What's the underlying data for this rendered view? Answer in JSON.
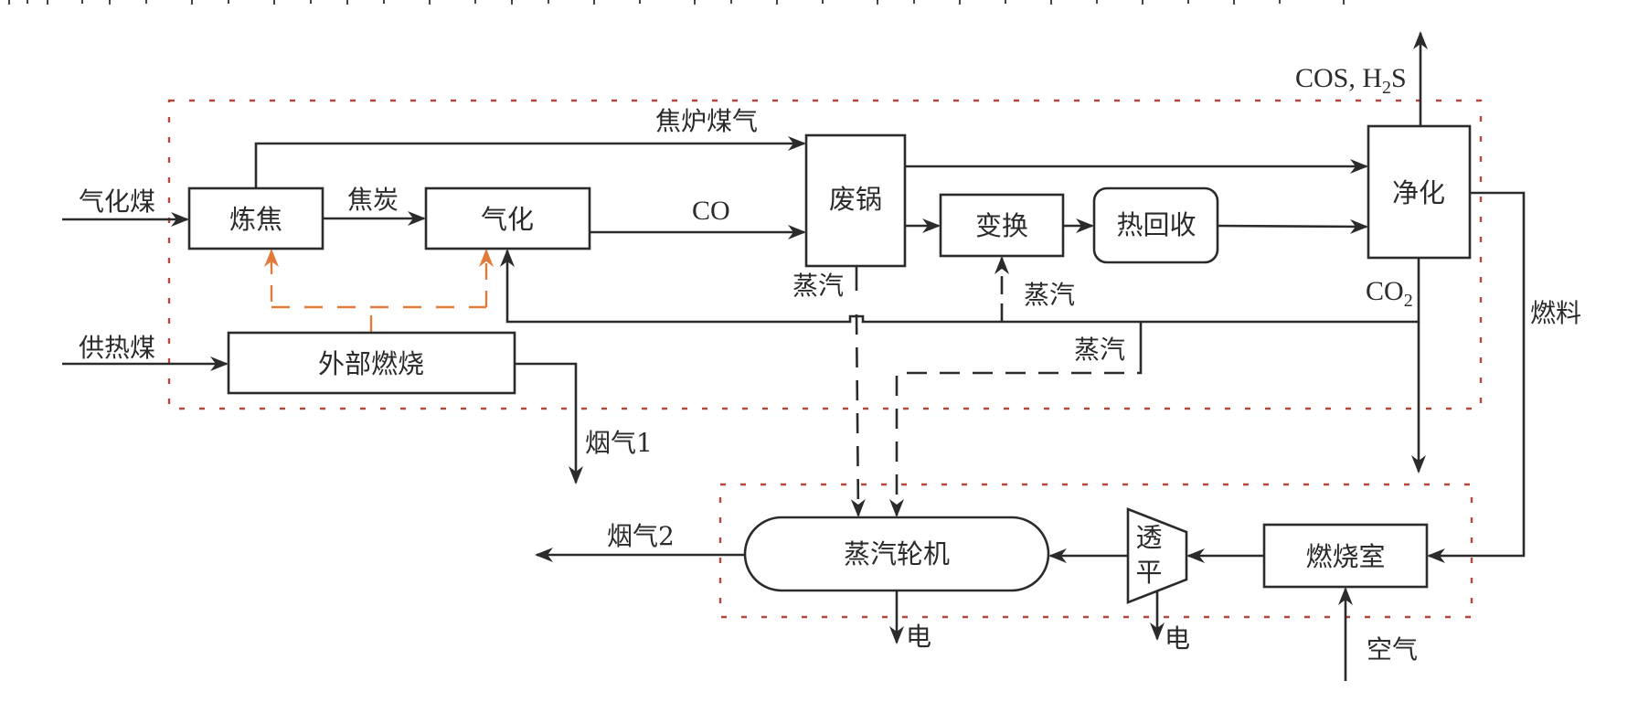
{
  "colors": {
    "stroke": "#2b2b2b",
    "heat_supply": "#e07b39",
    "boundary": "#b5473c"
  },
  "units": {
    "coking": "炼焦",
    "gasification": "气化",
    "external_combustion": "外部燃烧",
    "waste_boiler": "废锅",
    "shift": "变换",
    "heat_recovery": "热回收",
    "purification": "净化",
    "steam_turbine": "蒸汽轮机",
    "gas_turbine_line1": "透",
    "gas_turbine_line2": "平",
    "combustor": "燃烧室"
  },
  "streams": {
    "gasification_coal": "气化煤",
    "heating_coal": "供热煤",
    "coke": "焦炭",
    "coke_oven_gas": "焦炉煤气",
    "co": "CO",
    "steam_waste_boiler": "蒸汽",
    "steam_shift": "蒸汽",
    "steam_to_turbine": "蒸汽",
    "co2_main": "CO",
    "co2_sub": "2",
    "cos_main": "COS, H",
    "cos_sub": "2",
    "cos_tail": "S",
    "fuel": "燃料",
    "flue_gas_1": "烟气1",
    "flue_gas_2": "烟气2",
    "electricity_st": "电",
    "electricity_gt": "电",
    "air": "空气"
  }
}
